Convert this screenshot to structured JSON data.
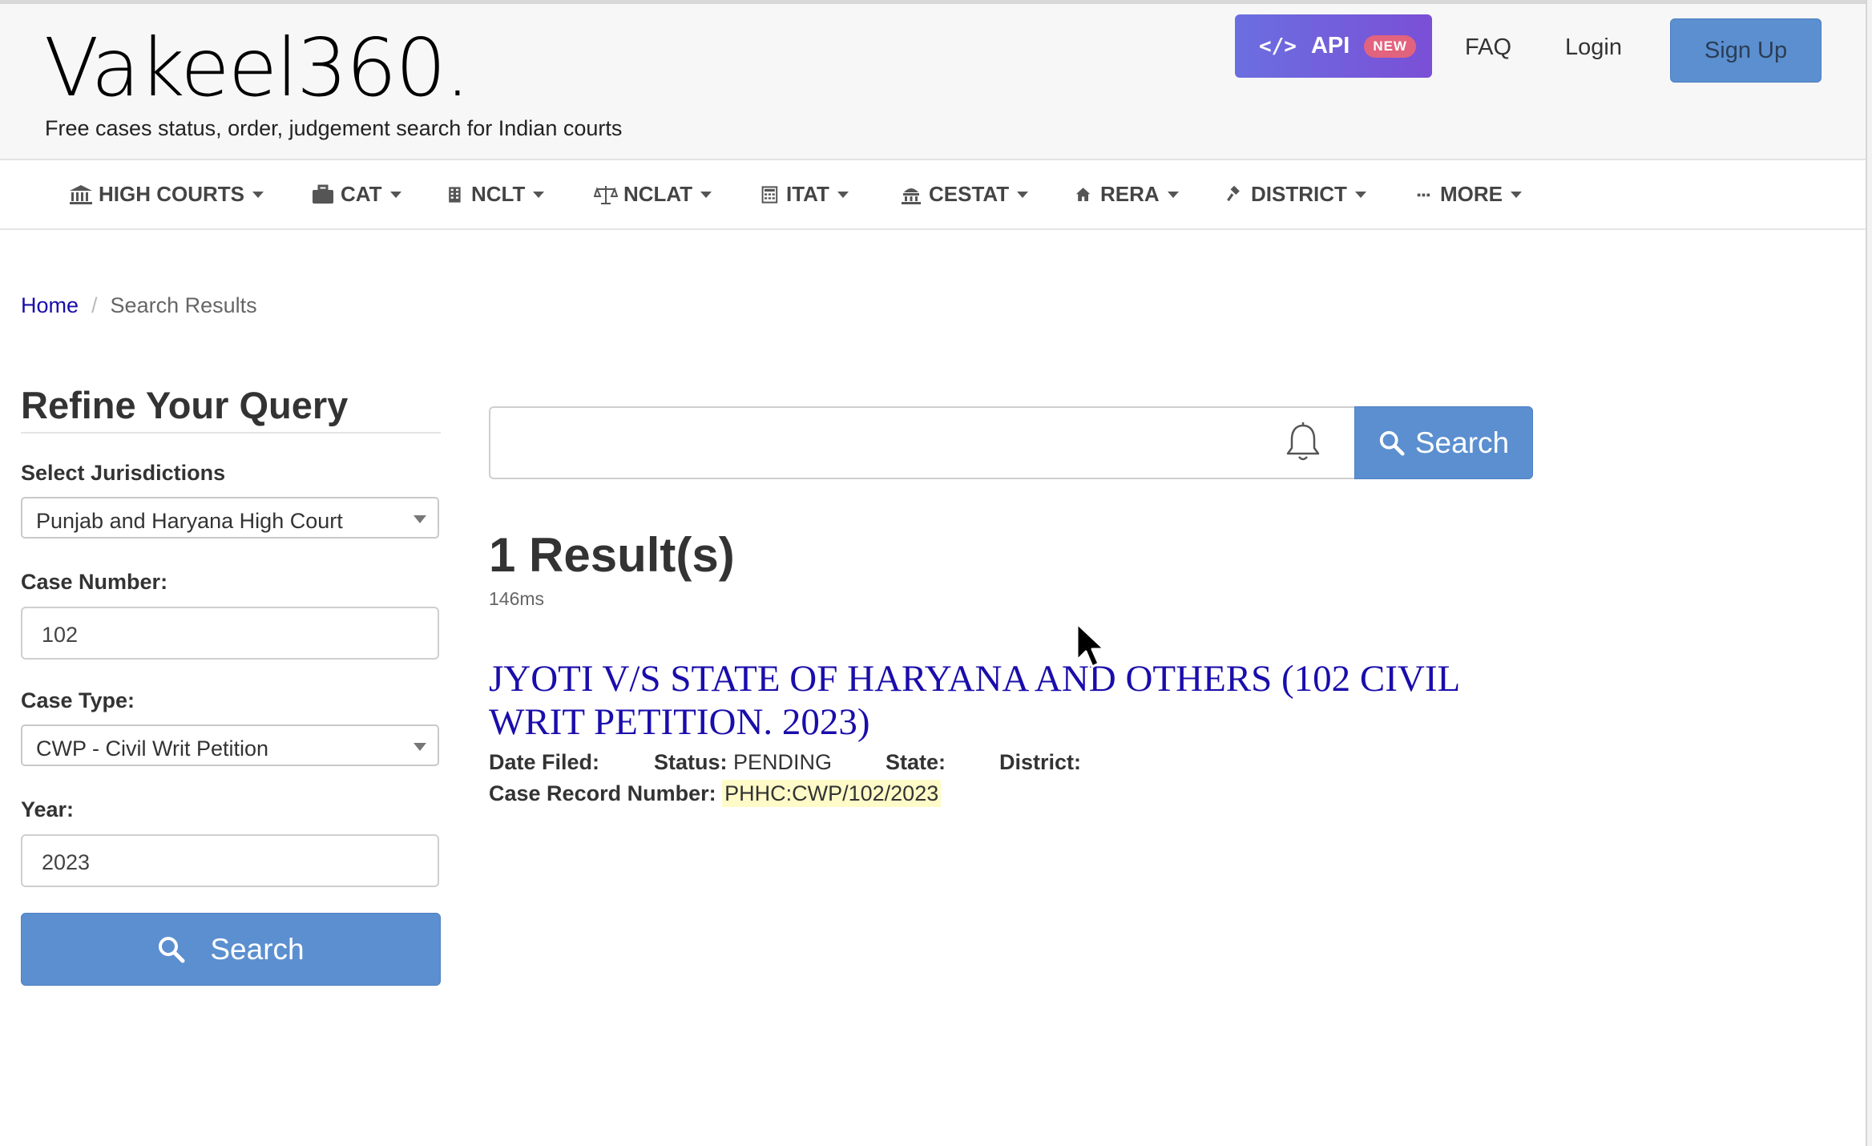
{
  "header": {
    "logo": "Vakeel360.",
    "tagline": "Free cases status, order, judgement search for Indian courts",
    "api_label": "API",
    "api_badge": "NEW",
    "faq": "FAQ",
    "login": "Login",
    "signup": "Sign Up"
  },
  "nav": {
    "items": [
      {
        "label": "HIGH COURTS",
        "icon": "bank-icon"
      },
      {
        "label": "CAT",
        "icon": "briefcase-icon"
      },
      {
        "label": "NCLT",
        "icon": "building-icon"
      },
      {
        "label": "NCLAT",
        "icon": "scales-icon"
      },
      {
        "label": "ITAT",
        "icon": "calculator-icon"
      },
      {
        "label": "CESTAT",
        "icon": "landmark-icon"
      },
      {
        "label": "RERA",
        "icon": "home-icon"
      },
      {
        "label": "DISTRICT",
        "icon": "gavel-icon"
      },
      {
        "label": "MORE",
        "icon": "ellipsis-icon"
      }
    ]
  },
  "breadcrumb": {
    "home": "Home",
    "separator": "/",
    "current": "Search Results"
  },
  "sidebar": {
    "title": "Refine Your Query",
    "jurisdiction_label": "Select Jurisdictions",
    "jurisdiction_value": "Punjab and Haryana High Court",
    "case_number_label": "Case Number:",
    "case_number_value": "102",
    "case_type_label": "Case Type:",
    "case_type_value": "CWP - Civil Writ Petition",
    "year_label": "Year:",
    "year_value": "2023",
    "search_label": "Search"
  },
  "main": {
    "search_value": "",
    "search_label": "Search",
    "result_count": "1 Result(s)",
    "timing": "146ms",
    "results": [
      {
        "title": "JYOTI V/S STATE OF HARYANA AND OTHERS (102 CIVIL WRIT PETITION. 2023)",
        "date_filed_label": "Date Filed:",
        "date_filed": "",
        "status_label": "Status:",
        "status": "PENDING",
        "state_label": "State:",
        "state": "",
        "district_label": "District:",
        "district": "",
        "record_label": "Case Record Number:",
        "record_number": "PHHC:CWP/102/2023"
      }
    ]
  },
  "colors": {
    "primary_button": "#5b8fd0",
    "api_gradient_start": "#6b6fe0",
    "api_gradient_end": "#7a4fd6",
    "new_badge": "#e2637d",
    "link": "#1a0dab",
    "highlight": "#fffbc8"
  }
}
